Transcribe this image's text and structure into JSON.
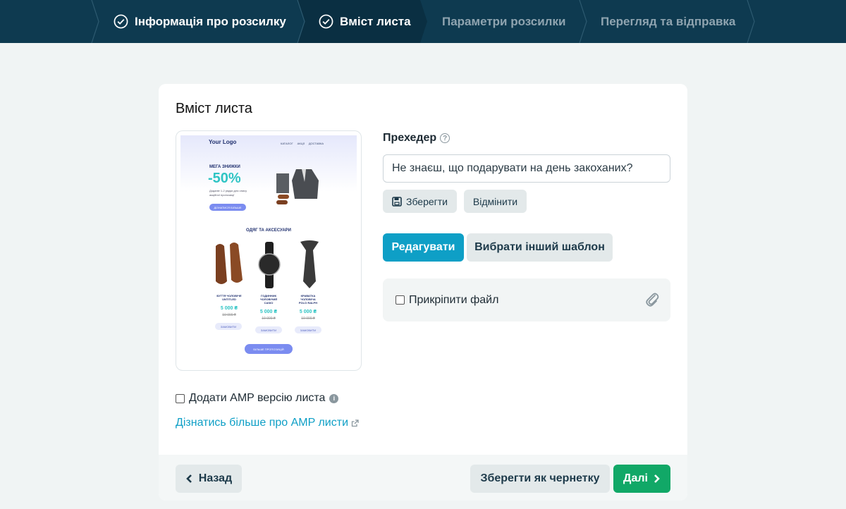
{
  "stepper": {
    "steps": [
      {
        "label": "Інформація про розсилку",
        "state": "done"
      },
      {
        "label": "Вміст листа",
        "state": "done"
      },
      {
        "label": "Параметри розсилки",
        "state": "todo"
      },
      {
        "label": "Перегляд та відправка",
        "state": "todo"
      }
    ]
  },
  "card": {
    "title": "Вміст листа"
  },
  "preview": {
    "logo_text": "Your Logo",
    "nav": [
      "КАТАЛОГ",
      "АКЦІЇ",
      "ДОСТАВКА"
    ],
    "promo_title": "МЕГА ЗНИЖКИ",
    "promo_percent": "-50%",
    "promo_desc": "Доданіе 1-2 рядки для опису акційної пропозиції",
    "promo_button": "ДІЗНАТИСЯ БІЛЬШЕ",
    "section_title": "ОДЯГ ТА АКСЕСУАРИ",
    "products": [
      {
        "name": "БУТТЯ ЧОЛОВІЧЕ\nUNTITLED",
        "price": "5 000 ₴",
        "old": "10 000 ₴",
        "button": "ЗАМОВИТИ"
      },
      {
        "name": "ГОДИННИК\nЧОЛОВІЧИЙ\nCASIO",
        "price": "5 000 ₴",
        "old": "10 000 ₴",
        "button": "ЗАМОВИТИ"
      },
      {
        "name": "КРАВАТКА\nЧОЛОВІЧА\nPOLO RALPH",
        "price": "5 000 ₴",
        "old": "10 000 ₴",
        "button": "ЗАМОВИТИ"
      }
    ],
    "more_button": "БІЛЬШЕ ПРОПОЗИЦІЙ"
  },
  "preheader": {
    "label": "Прехедер",
    "value": "Не знаєш, що подарувати на день закоханих?",
    "save_label": "Зберегти",
    "cancel_label": "Відмінити"
  },
  "actions": {
    "edit_label": "Редагувати",
    "template_label": "Вибрати інший шаблон"
  },
  "attach": {
    "label": "Прикріпити файл",
    "checked": false
  },
  "amp": {
    "label": "Додати AMP версію листа",
    "checked": false,
    "link_label": "Дізнатись більше про AMP листи"
  },
  "footer": {
    "back_label": "Назад",
    "draft_label": "Зберегти як чернетку",
    "next_label": "Далі"
  },
  "colors": {
    "stepper_bg": "#0e3a50",
    "primary": "#0e9fc6",
    "success": "#11a867",
    "gray_button": "#e3e9ea",
    "preview_accent": "#7b8cf0"
  }
}
